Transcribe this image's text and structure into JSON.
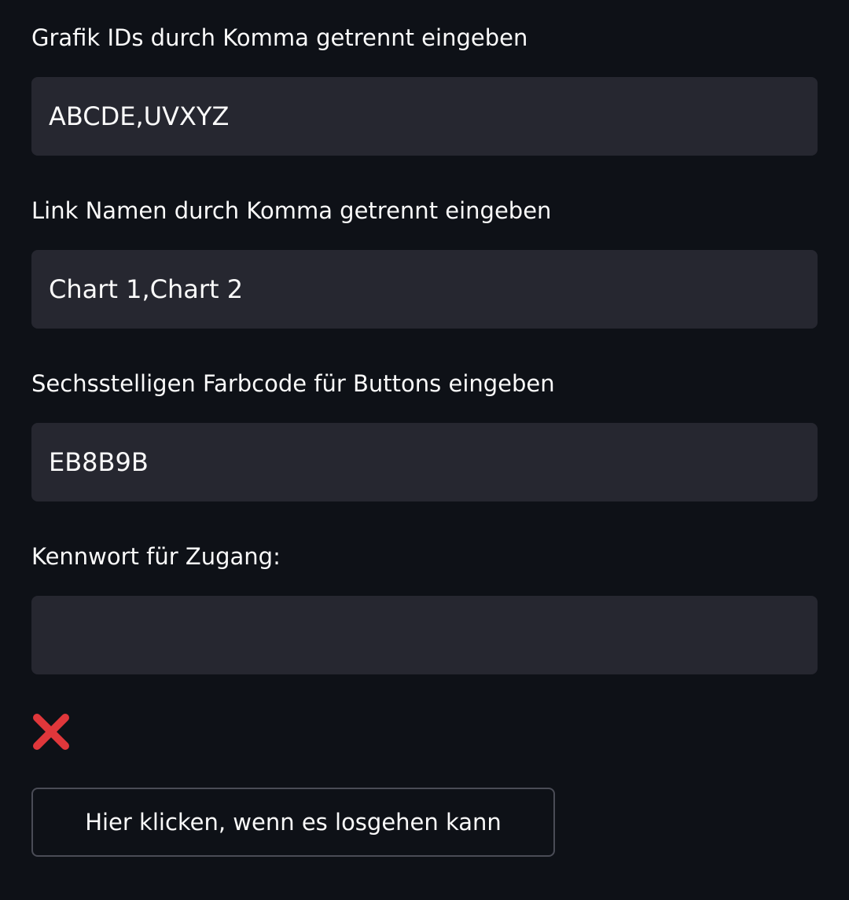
{
  "fields": [
    {
      "label": "Grafik IDs durch Komma getrennt eingeben",
      "value": "ABCDE,UVXYZ"
    },
    {
      "label": "Link Namen durch Komma getrennt eingeben",
      "value": "Chart 1,Chart 2"
    },
    {
      "label": "Sechsstelligen Farbcode für Buttons eingeben",
      "value": "EB8B9B"
    },
    {
      "label": "Kennwort für Zugang:",
      "value": ""
    }
  ],
  "status": {
    "icon": "cross-mark-icon",
    "color": "#e0373b"
  },
  "button": {
    "label": "Hier klicken, wenn es losgehen kann"
  }
}
